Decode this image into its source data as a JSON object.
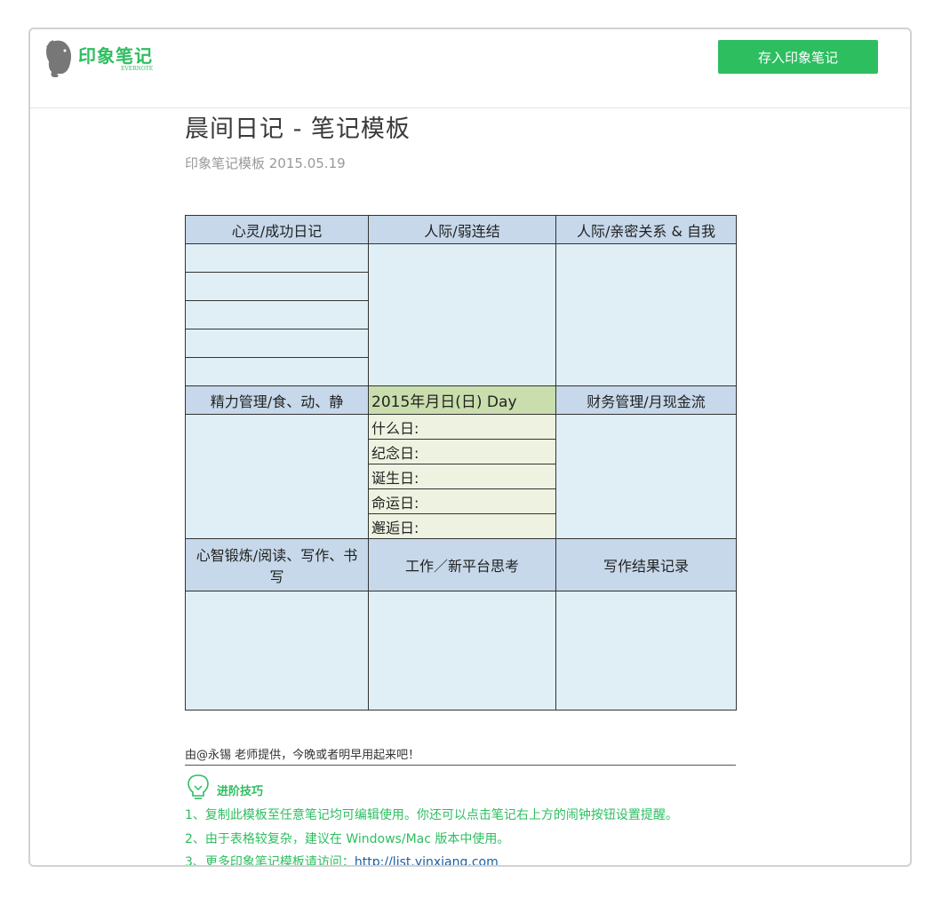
{
  "header": {
    "logo_text": "印象笔记",
    "logo_sub": "EVERNOTE",
    "save_button": "存入印象笔记"
  },
  "note": {
    "title": "晨间日记 - 笔记模板",
    "subtitle": "印象笔记模板 2015.05.19"
  },
  "table": {
    "row1_headers": [
      "心灵/成功日记",
      "人际/弱连结",
      "人际/亲密关系 & 自我"
    ],
    "row2_headers": [
      "精力管理/食、动、静",
      "2015年月日(日) Day",
      "财务管理/月现金流"
    ],
    "day_items": [
      "什么日:",
      "纪念日:",
      "诞生日:",
      "命运日:",
      "邂逅日:"
    ],
    "row3_headers": [
      "心智锻炼/阅读、写作、书写",
      "工作／新平台思考",
      "写作结果记录"
    ]
  },
  "footer": {
    "credit": "由@永锡 老师提供，今晚或者明早用起来吧！",
    "tips_title": "进阶技巧",
    "tip1": "1、复制此模板至任意笔记均可编辑使用。你还可以点击笔记右上方的闹钟按钮设置提醒。",
    "tip2": "2、由于表格较复杂，建议在 Windows/Mac 版本中使用。",
    "tip3_prefix": "3、更多印象笔记模板请访问：",
    "tip3_link": "http://list.yinxiang.com"
  },
  "colors": {
    "brand_green": "#2dbe60",
    "header_blue": "#c6d8ea",
    "cell_blue": "#e0eff5",
    "date_green": "#c9deac",
    "light_green": "#eef3e1",
    "link_blue": "#1b5fa3"
  },
  "icons": {
    "logo": "elephant-icon",
    "tips": "lightbulb-icon"
  }
}
